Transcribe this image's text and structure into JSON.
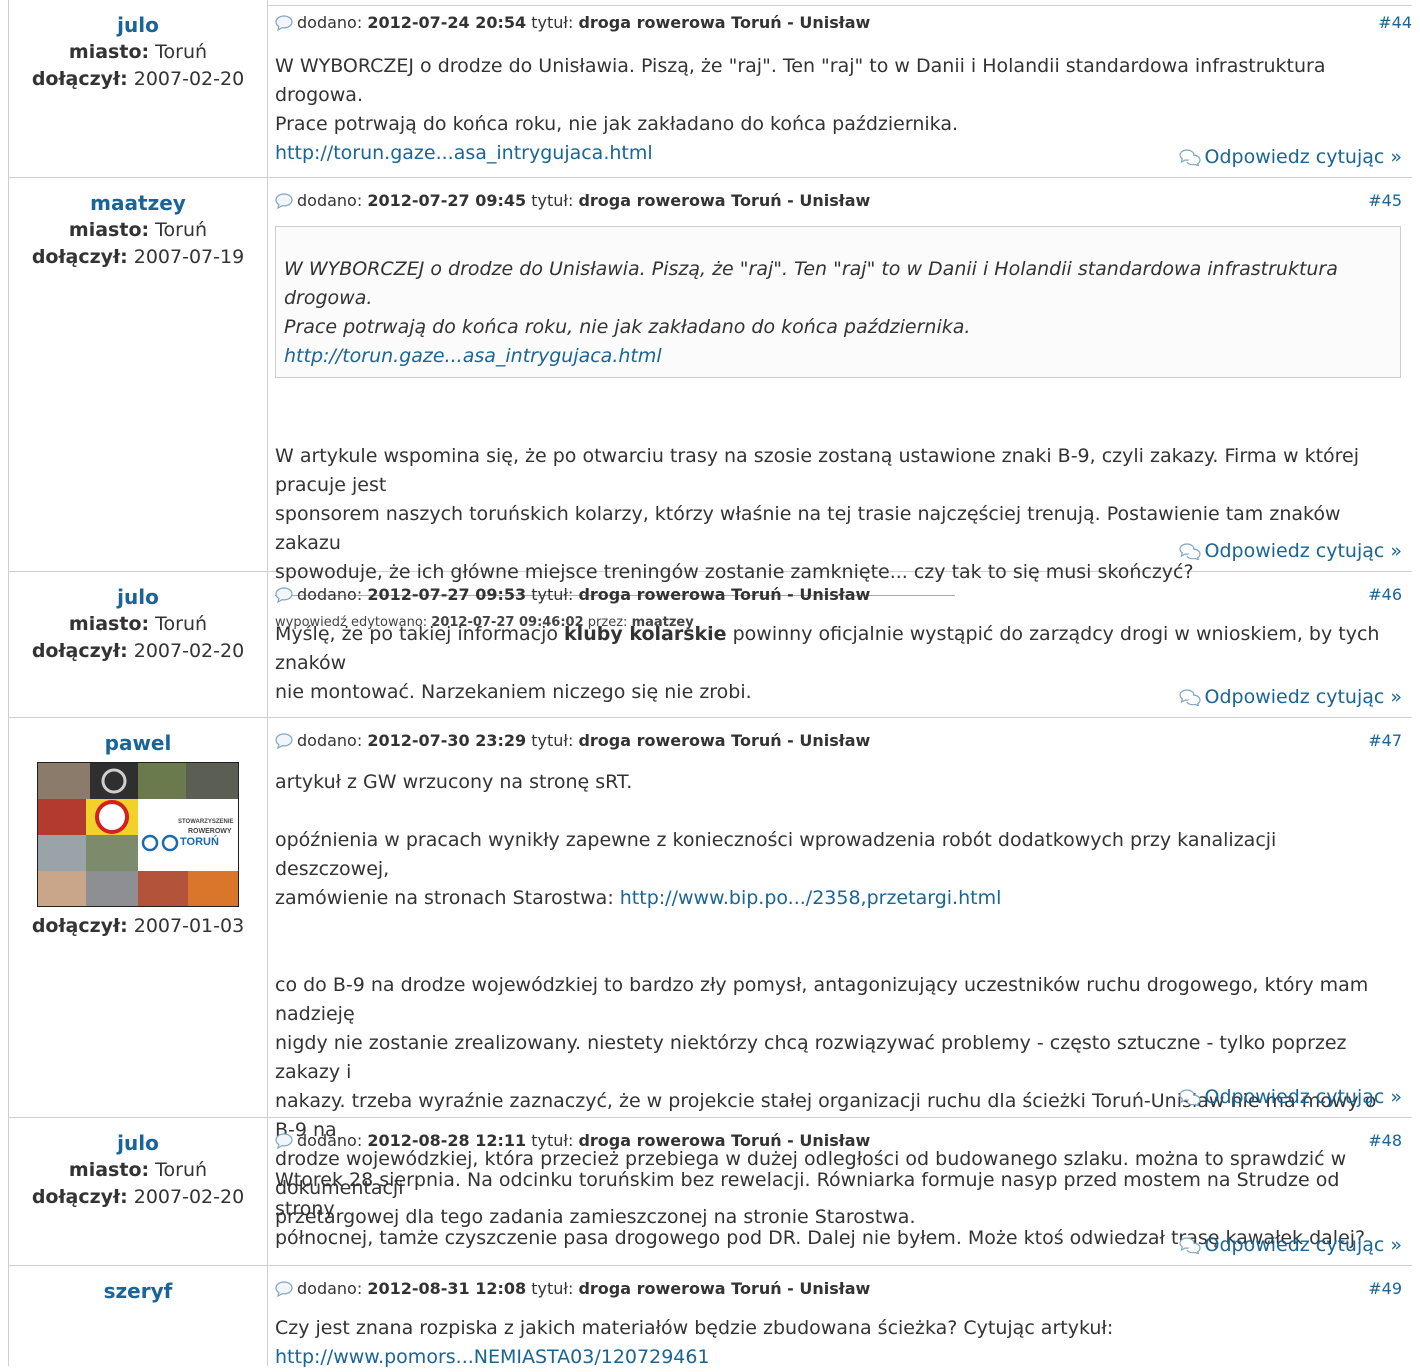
{
  "meta_labels": {
    "added": "dodano:",
    "title": "tytuł:",
    "reply": "Odpowiedz cytując »",
    "city": "miasto:",
    "joined": "dołączył:"
  },
  "posts": [
    {
      "author": "julo",
      "city": "Toruń",
      "joined": "2007-02-20",
      "date": "2012-07-24 20:54",
      "thread": "droga rowerowa Toruń - Unisław",
      "number": "#44",
      "lines": [
        "W WYBORCZEJ o drodze do Unisławia. Piszą, że \"raj\". Ten \"raj\" to w Danii i Holandii standardowa infrastruktura drogowa.",
        "Prace potrwają do końca roku, nie jak zakładano do końca października."
      ],
      "link": "http://torun.gaze...asa_intrygujaca.html"
    },
    {
      "author": "maatzey",
      "city": "Toruń",
      "joined": "2007-07-19",
      "date": "2012-07-27 09:45",
      "thread": "droga rowerowa Toruń - Unisław",
      "number": "#45",
      "quote_lines": [
        "W WYBORCZEJ o drodze do Unisławia. Piszą, że \"raj\". Ten \"raj\" to w Danii i Holandii standardowa infrastruktura drogowa.",
        "Prace potrwają do końca roku, nie jak zakładano do końca października."
      ],
      "quote_link": "http://torun.gaze...asa_intrygujaca.html",
      "lines": [
        "W artykule wspomina się, że po otwarciu trasy na szosie zostaną ustawione znaki B-9, czyli zakazy. Firma w której pracuje jest",
        "sponsorem naszych toruńskich kolarzy, którzy właśnie na tej trasie najczęściej trenują. Postawienie tam znaków zakazu",
        "spowoduje, że ich główne miejsce treningów zostanie zamknięte... czy tak to się musi skończyć?"
      ],
      "edited_label": "wypowiedź edytowano:",
      "edited_date": "2012-07-27 09:46:02",
      "edited_by_label": "przez:",
      "edited_by": "maatzey"
    },
    {
      "author": "julo",
      "city": "Toruń",
      "joined": "2007-02-20",
      "date": "2012-07-27 09:53",
      "thread": "droga rowerowa Toruń - Unisław",
      "number": "#46",
      "line1_before": "Myślę, że po takiej informacjo ",
      "line1_bold": "kluby kolarskie",
      "line1_after": " powinny oficjalnie wystąpić do zarządcy drogi w wnioskiem, by tych znaków",
      "line2": "nie montować. Narzekaniem niczego się nie zrobi."
    },
    {
      "author": "pawel",
      "joined": "2007-01-03",
      "avatar_text": [
        "STOWARZYSZENIE",
        "ROWEROWY",
        "TORUŃ"
      ],
      "date": "2012-07-30 23:29",
      "thread": "droga rowerowa Toruń - Unisław",
      "number": "#47",
      "p1": "artykuł z GW wrzucony na stronę sRT.",
      "p2a": "opóźnienia w pracach wynikły zapewne z konieczności wprowadzenia robót dodatkowych przy kanalizacji deszczowej,",
      "p2b": "zamówienie na stronach Starostwa: ",
      "p2_link": "http://www.bip.po.../2358,przetargi.html",
      "p3": [
        "co do B-9 na drodze wojewódzkiej to bardzo zły pomysł, antagonizujący uczestników ruchu drogowego, który mam nadzieję",
        "nigdy nie zostanie zrealizowany. niestety niektórzy chcą rozwiązywać problemy - często sztuczne - tylko poprzez zakazy i",
        "nakazy. trzeba wyraźnie zaznaczyć, że w projekcie stałej organizacji ruchu dla ścieżki Toruń-Unisław nie ma mowy o B-9 na",
        "drodze wojewódzkiej, która przecież przebiega w dużej odległości od budowanego szlaku. można to sprawdzić w dokumentacji",
        "przetargowej dla tego zadania zamieszczonej na stronie Starostwa."
      ]
    },
    {
      "author": "julo",
      "city": "Toruń",
      "joined": "2007-02-20",
      "date": "2012-08-28 12:11",
      "thread": "droga rowerowa Toruń - Unisław",
      "number": "#48",
      "lines": [
        "Wtorek 28 sierpnia. Na odcinku toruńskim bez rewelacji. Równiarka formuje nasyp przed mostem na Strudze od strony",
        "północnej, tamże czyszczenie pasa drogowego pod DR. Dalej nie byłem. Może ktoś odwiedzał trasę kawałek dalej?"
      ]
    },
    {
      "author": "szeryf",
      "date": "2012-08-31 12:08",
      "thread": "droga rowerowa Toruń - Unisław",
      "number": "#49",
      "lines": [
        "Czy jest znana rozpiska z jakich materiałów będzie zbudowana ścieżka? Cytując artykuł:"
      ],
      "link": "http://www.pomors...NEMIASTA03/120729461"
    }
  ],
  "colors": {
    "link": "#1a6496",
    "border": "#cfcfcf",
    "text": "#333333"
  },
  "icons": {
    "meta": "comment-bubble-icon",
    "reply": "reply-bubbles-icon"
  }
}
